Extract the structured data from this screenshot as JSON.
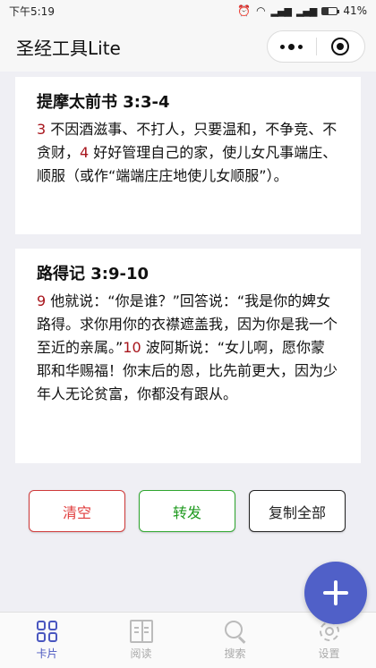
{
  "status": {
    "time": "下午5:19",
    "battery": "41%",
    "battery_level": 0.41
  },
  "nav": {
    "title": "圣经工具Lite"
  },
  "cards": [
    {
      "ref": "提摩太前书 3:3-4",
      "segments": [
        {
          "num": "3",
          "text": " 不因酒滋事、不打人，只要温和，不争竞、不贪财，"
        },
        {
          "num": "4",
          "text": " 好好管理自己的家，使儿女凡事端庄、顺服（或作“端端庄庄地使儿女顺服”）。"
        }
      ]
    },
    {
      "ref": "路得记 3:9-10",
      "segments": [
        {
          "num": "9",
          "text": " 他就说：“你是谁？”回答说：“我是你的婢女路得。求你用你的衣襟遮盖我，因为你是我一个至近的亲属。”"
        },
        {
          "num": "10",
          "text": " 波阿斯说：“女儿啊，愿你蒙耶和华赐福！你末后的恩，比先前更大，因为少年人无论贫富，你都没有跟从。"
        }
      ]
    }
  ],
  "buttons": {
    "clear": "清空",
    "forward": "转发",
    "copy_all": "复制全部"
  },
  "tabs": [
    {
      "label": "卡片",
      "icon": "cards-icon",
      "active": true
    },
    {
      "label": "阅读",
      "icon": "book-icon",
      "active": false
    },
    {
      "label": "搜索",
      "icon": "search-icon",
      "active": false
    },
    {
      "label": "设置",
      "icon": "gear-icon",
      "active": false
    }
  ],
  "colors": {
    "accent": "#4a57c0",
    "verse_number": "#a8161d",
    "fab": "#5060c8"
  }
}
